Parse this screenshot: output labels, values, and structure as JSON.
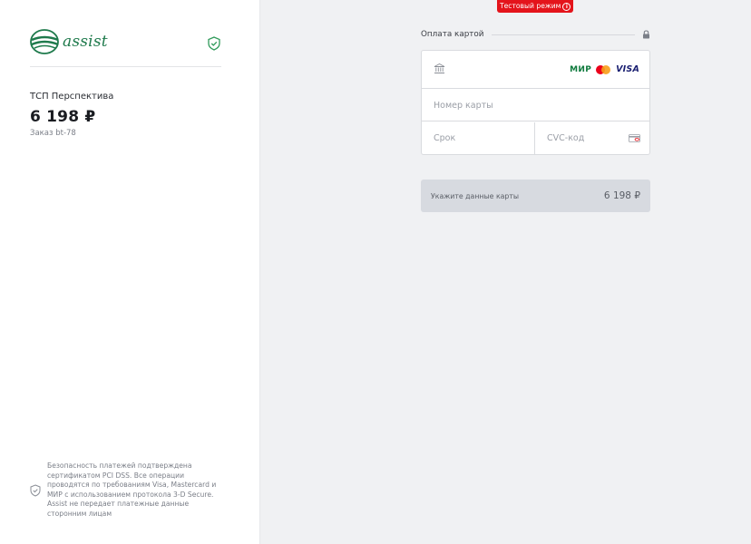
{
  "logo": {
    "text": "assist"
  },
  "merchant": {
    "name": "ТСП Перспектива",
    "amount": "6 198 ₽",
    "order": "Заказ bt-78"
  },
  "security": {
    "text": "Безопасность платежей подтверждена сертификатом PCI DSS. Все операции проводятся по требованиям Visa, Mastercard и МИР с использованием протокола 3-D Secure. Assist не передает платежные данные сторонним лицам"
  },
  "test_mode": {
    "label": "Тестовый режим",
    "info": "i"
  },
  "card_form": {
    "title": "Оплата картой",
    "brands": {
      "mir": "МИР",
      "visa": "VISA"
    },
    "number_placeholder": "Номер карты",
    "expiry_placeholder": "Срок",
    "cvc_placeholder": "CVC-код"
  },
  "pay_button": {
    "label": "Укажите данные карты",
    "amount": "6 198 ₽"
  },
  "colors": {
    "brand_green": "#1f7a4c",
    "test_badge": "#e4141b",
    "button_disabled": "#d7dae0"
  }
}
